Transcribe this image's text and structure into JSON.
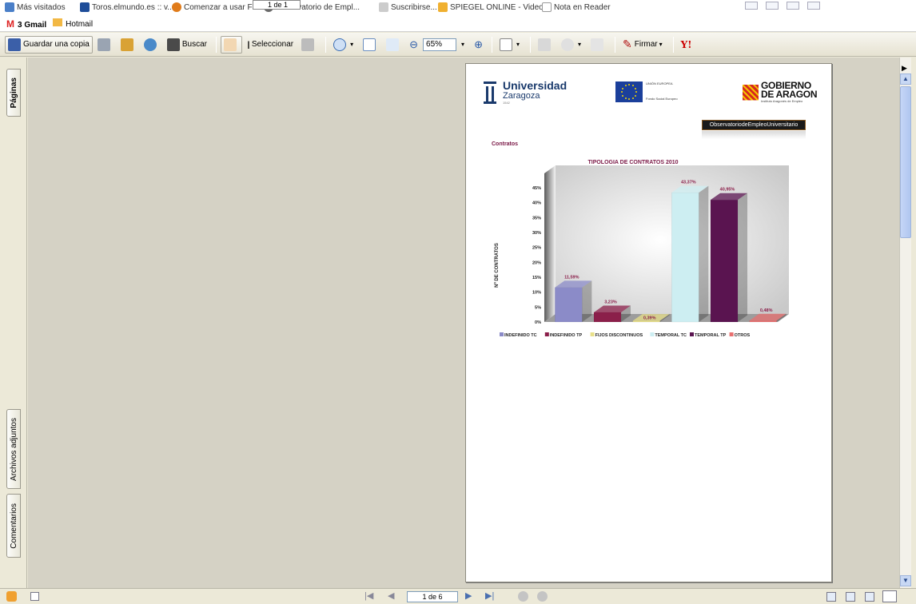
{
  "bookmarks": {
    "items": [
      "Más visitados",
      "Toros.elmundo.es :: v...",
      "Comenzar a usar Firef...",
      "Observatorio de Empl...",
      "Suscribirse...",
      "SPIEGEL ONLINE - Video",
      "Nota en Reader"
    ],
    "pager": "1 de 1"
  },
  "mailbar": {
    "gmail": "3 Gmail",
    "hotmail": "Hotmail"
  },
  "toolbar": {
    "save_copy": "Guardar una copia",
    "search": "Buscar",
    "select": "Seleccionar",
    "zoom": "65%",
    "sign": "Firmar",
    "yahoo": "Y!"
  },
  "leftnav": {
    "pages_tab": "Páginas",
    "attachments_tab": "Archivos adjuntos",
    "comments_tab": "Comentarios"
  },
  "document": {
    "uz_title": "Universidad",
    "uz_subtitle": "Zaragoza",
    "uz_year": "1542",
    "eu_title": "UNIÓN EUROPEA",
    "eu_subtitle": "Fondo Social Europeo",
    "aragon_line1": "GOBIERNO",
    "aragon_line2": "DE ARAGON",
    "aragon_sub": "Instituto Aragonés de Empleo",
    "observatorio": "ObservatoriodeEmpleoUniversitario",
    "section": "Contratos"
  },
  "chart_data": {
    "type": "bar",
    "title": "TIPOLOGIA DE CONTRATOS 2010",
    "ylabel": "Nº DE CONTRATOS",
    "yticks": [
      "0%",
      "5%",
      "10%",
      "15%",
      "20%",
      "25%",
      "30%",
      "35%",
      "40%",
      "45%"
    ],
    "ylim": [
      0,
      45
    ],
    "categories": [
      "INDEFINIDO TC",
      "INDEFINIDO TP",
      "FIJOS DISCONTINUOS",
      "TEMPORAL TC",
      "TEMPORAL TP",
      "OTROS"
    ],
    "values": [
      11.59,
      3.23,
      0.39,
      43.37,
      40.95,
      0.48
    ],
    "labels": [
      "11,59%",
      "3,23%",
      "0,39%",
      "43,37%",
      "40,95%",
      "0,48%"
    ],
    "colors": [
      "#8b8bc8",
      "#8b1f4a",
      "#e8e08a",
      "#cdeef2",
      "#5a1450",
      "#e87070"
    ],
    "legend": "bottom"
  },
  "statusbar": {
    "page": "1 de 6"
  }
}
